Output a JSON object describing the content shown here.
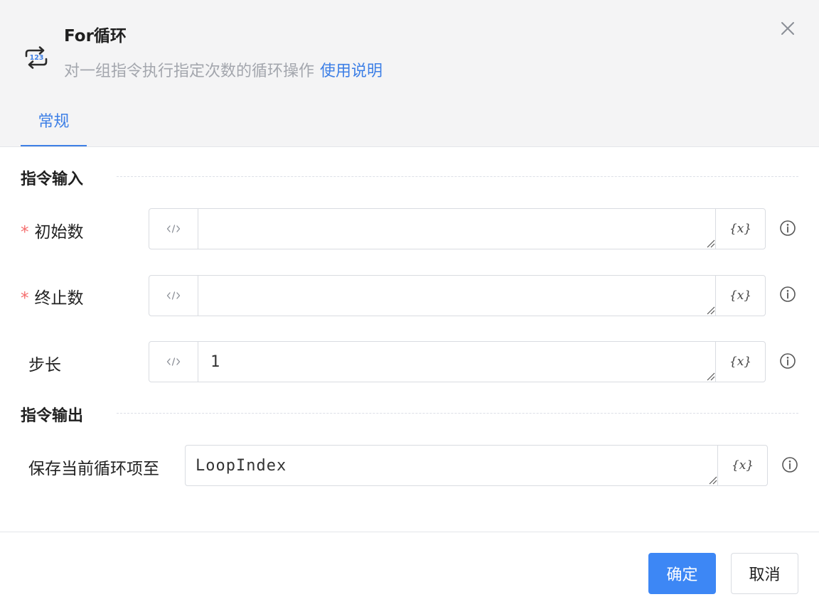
{
  "header": {
    "title": "For循环",
    "subtitle": "对一组指令执行指定次数的循环操作",
    "help_link": "使用说明",
    "app_icon": "loop-123-icon",
    "close_icon": "close-icon"
  },
  "tabs": [
    {
      "label": "常规",
      "active": true
    }
  ],
  "sections": {
    "input_title": "指令输入",
    "output_title": "指令输出"
  },
  "fields": {
    "start": {
      "label": "初始数",
      "required_mark": "*",
      "value": ""
    },
    "end": {
      "label": "终止数",
      "required_mark": "*",
      "value": ""
    },
    "step": {
      "label": "步长",
      "value": "1"
    },
    "save": {
      "label": "保存当前循环项至",
      "value": "LoopIndex"
    }
  },
  "variable_button": "{x}",
  "buttons": {
    "ok": "确定",
    "cancel": "取消"
  },
  "colors": {
    "accent": "#3d7fe6",
    "primary_button": "#3d87f5",
    "required": "#f56c6c",
    "header_bg": "#f4f4f5"
  }
}
